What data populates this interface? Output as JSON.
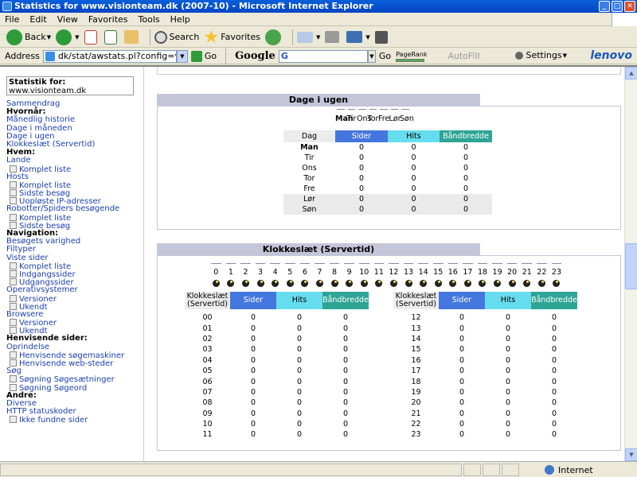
{
  "window": {
    "title": "Statistics for www.visionteam.dk (2007-10) - Microsoft Internet Explorer"
  },
  "menu": [
    "File",
    "Edit",
    "View",
    "Favorites",
    "Tools",
    "Help"
  ],
  "toolbar": {
    "back": "Back",
    "search": "Search",
    "favorites": "Favorites"
  },
  "address": {
    "label": "Address",
    "url": "dk/stat/awstats.pl?config=visionteam.dk",
    "go": "Go"
  },
  "google": {
    "logo": "Google",
    "go": "Go",
    "pagerank": "PageRank",
    "autofill": "AutoFill",
    "settings": "Settings",
    "brand": "lenovo"
  },
  "sidebar": {
    "stat_label": "Statistik for:",
    "stat_site": "www.visionteam.dk",
    "items": [
      {
        "t": "link",
        "label": "Sammendrag"
      },
      {
        "t": "hdr",
        "label": "Hvornår:"
      },
      {
        "t": "link",
        "label": "Månedlig historie"
      },
      {
        "t": "link",
        "label": "Dage i måneden"
      },
      {
        "t": "link",
        "label": "Dage i ugen"
      },
      {
        "t": "link",
        "label": "Klokkeslæt (Servertid)"
      },
      {
        "t": "hdr",
        "label": "Hvem:"
      },
      {
        "t": "link",
        "label": "Lande"
      },
      {
        "t": "sub",
        "label": "Komplet liste"
      },
      {
        "t": "link",
        "label": "Hosts"
      },
      {
        "t": "sub",
        "label": "Komplet liste"
      },
      {
        "t": "sub",
        "label": "Sidste besøg"
      },
      {
        "t": "sub",
        "label": "Uopløste IP-adresser"
      },
      {
        "t": "link",
        "label": "Robotter/Spiders besøgende"
      },
      {
        "t": "sub",
        "label": "Komplet liste"
      },
      {
        "t": "sub",
        "label": "Sidste besøg"
      },
      {
        "t": "hdr",
        "label": "Navigation:"
      },
      {
        "t": "link",
        "label": "Besøgets varighed"
      },
      {
        "t": "link",
        "label": "Filtyper"
      },
      {
        "t": "link",
        "label": "Viste sider"
      },
      {
        "t": "sub",
        "label": "Komplet liste"
      },
      {
        "t": "sub",
        "label": "Indgangssider"
      },
      {
        "t": "sub",
        "label": "Udgangssider"
      },
      {
        "t": "link",
        "label": "Operativsystemer"
      },
      {
        "t": "sub",
        "label": "Versioner"
      },
      {
        "t": "sub",
        "label": "Ukendt"
      },
      {
        "t": "link",
        "label": "Browsere"
      },
      {
        "t": "sub",
        "label": "Versioner"
      },
      {
        "t": "sub",
        "label": "Ukendt"
      },
      {
        "t": "hdr",
        "label": "Henvisende sider:"
      },
      {
        "t": "link",
        "label": "Oprindelse"
      },
      {
        "t": "sub",
        "label": "Henvisende søgemaskiner"
      },
      {
        "t": "sub",
        "label": "Henvisende web-steder"
      },
      {
        "t": "link",
        "label": "Søg"
      },
      {
        "t": "sub",
        "label": "Søgning Søgesætninger"
      },
      {
        "t": "sub",
        "label": "Søgning Søgeord"
      },
      {
        "t": "hdr",
        "label": "Andre:"
      },
      {
        "t": "link",
        "label": "Diverse"
      },
      {
        "t": "link",
        "label": "HTTP statuskoder"
      },
      {
        "t": "sub",
        "label": "Ikke fundne sider"
      }
    ]
  },
  "days": {
    "title": "Dage i ugen",
    "chart_labels": [
      "Man",
      "Tir",
      "Ons",
      "Tor",
      "Fre",
      "Lør",
      "Søn"
    ],
    "headers": [
      "Dag",
      "Sider",
      "Hits",
      "Båndbredde"
    ],
    "rows": [
      {
        "day": "Man",
        "sider": "0",
        "hits": "0",
        "bw": "0",
        "bold": true,
        "we": false
      },
      {
        "day": "Tir",
        "sider": "0",
        "hits": "0",
        "bw": "0",
        "bold": false,
        "we": false
      },
      {
        "day": "Ons",
        "sider": "0",
        "hits": "0",
        "bw": "0",
        "bold": false,
        "we": false
      },
      {
        "day": "Tor",
        "sider": "0",
        "hits": "0",
        "bw": "0",
        "bold": false,
        "we": false
      },
      {
        "day": "Fre",
        "sider": "0",
        "hits": "0",
        "bw": "0",
        "bold": false,
        "we": false
      },
      {
        "day": "Lør",
        "sider": "0",
        "hits": "0",
        "bw": "0",
        "bold": false,
        "we": true
      },
      {
        "day": "Søn",
        "sider": "0",
        "hits": "0",
        "bw": "0",
        "bold": false,
        "we": true
      }
    ]
  },
  "hours": {
    "title": "Klokkeslæt (Servertid)",
    "chart_labels": [
      "0",
      "1",
      "2",
      "3",
      "4",
      "5",
      "6",
      "7",
      "8",
      "9",
      "10",
      "11",
      "12",
      "13",
      "14",
      "15",
      "16",
      "17",
      "18",
      "19",
      "20",
      "21",
      "22",
      "23"
    ],
    "headers": [
      "Klokkeslæt (Servertid)",
      "Sider",
      "Hits",
      "Båndbredde"
    ],
    "left": [
      {
        "h": "00",
        "sider": "0",
        "hits": "0",
        "bw": "0"
      },
      {
        "h": "01",
        "sider": "0",
        "hits": "0",
        "bw": "0"
      },
      {
        "h": "02",
        "sider": "0",
        "hits": "0",
        "bw": "0"
      },
      {
        "h": "03",
        "sider": "0",
        "hits": "0",
        "bw": "0"
      },
      {
        "h": "04",
        "sider": "0",
        "hits": "0",
        "bw": "0"
      },
      {
        "h": "05",
        "sider": "0",
        "hits": "0",
        "bw": "0"
      },
      {
        "h": "06",
        "sider": "0",
        "hits": "0",
        "bw": "0"
      },
      {
        "h": "07",
        "sider": "0",
        "hits": "0",
        "bw": "0"
      },
      {
        "h": "08",
        "sider": "0",
        "hits": "0",
        "bw": "0"
      },
      {
        "h": "09",
        "sider": "0",
        "hits": "0",
        "bw": "0"
      },
      {
        "h": "10",
        "sider": "0",
        "hits": "0",
        "bw": "0"
      },
      {
        "h": "11",
        "sider": "0",
        "hits": "0",
        "bw": "0"
      }
    ],
    "right": [
      {
        "h": "12",
        "sider": "0",
        "hits": "0",
        "bw": "0"
      },
      {
        "h": "13",
        "sider": "0",
        "hits": "0",
        "bw": "0"
      },
      {
        "h": "14",
        "sider": "0",
        "hits": "0",
        "bw": "0"
      },
      {
        "h": "15",
        "sider": "0",
        "hits": "0",
        "bw": "0"
      },
      {
        "h": "16",
        "sider": "0",
        "hits": "0",
        "bw": "0"
      },
      {
        "h": "17",
        "sider": "0",
        "hits": "0",
        "bw": "0"
      },
      {
        "h": "18",
        "sider": "0",
        "hits": "0",
        "bw": "0"
      },
      {
        "h": "19",
        "sider": "0",
        "hits": "0",
        "bw": "0"
      },
      {
        "h": "20",
        "sider": "0",
        "hits": "0",
        "bw": "0"
      },
      {
        "h": "21",
        "sider": "0",
        "hits": "0",
        "bw": "0"
      },
      {
        "h": "22",
        "sider": "0",
        "hits": "0",
        "bw": "0"
      },
      {
        "h": "23",
        "sider": "0",
        "hits": "0",
        "bw": "0"
      }
    ]
  },
  "status": {
    "zone": "Internet"
  },
  "colors": {
    "sider": "#4477dd",
    "hits": "#66ddee",
    "bandwidth": "#2ea495",
    "section_title": "#c5c5d9"
  }
}
